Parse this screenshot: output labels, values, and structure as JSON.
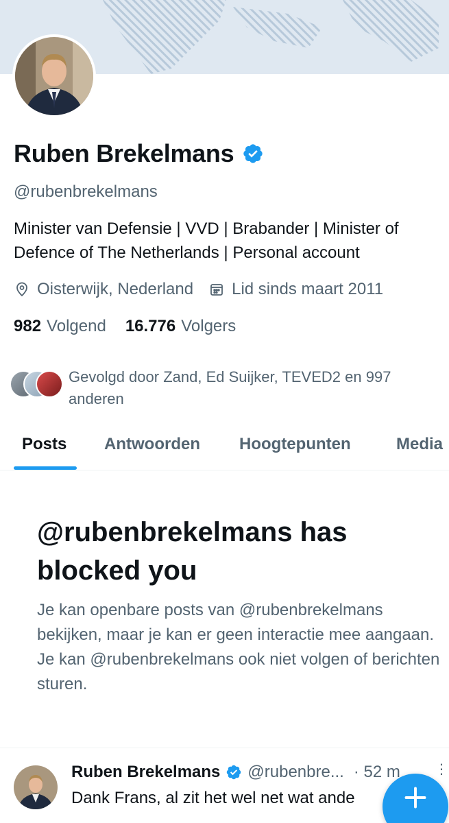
{
  "profile": {
    "name": "Ruben Brekelmans",
    "handle": "@rubenbrekelmans",
    "bio": "Minister van Defensie | VVD | Brabander |  Minister of\nDefence of The Netherlands | Personal account",
    "location": "Oisterwijk, Nederland",
    "joined": "Lid sinds maart 2011",
    "following_count": "982",
    "following_label": "Volgend",
    "followers_count": "16.776",
    "followers_label": "Volgers",
    "followed_by": "Gevolgd door Zand, Ed Suijker, TEVED2 en 997 anderen"
  },
  "tabs": [
    {
      "label": "Posts",
      "active": true
    },
    {
      "label": "Antwoorden",
      "active": false
    },
    {
      "label": "Hoogtepunten",
      "active": false
    },
    {
      "label": "Media",
      "active": false
    }
  ],
  "blocked": {
    "title": "@rubenbrekelmans has blocked you",
    "message": "Je kan openbare posts van @rubenbrekelmans bekijken, maar je kan er geen interactie mee aangaan. Je kan @rubenbrekelmans ook niet volgen of berichten sturen."
  },
  "post": {
    "author": "Ruben Brekelmans",
    "handle": "@rubenbre...",
    "time": "· 52 m",
    "text": "Dank Frans, al zit het wel net wat ande"
  },
  "icons": {
    "location": "location-pin-icon",
    "calendar": "calendar-icon",
    "verified": "verified-badge-icon",
    "compose": "plus-icon",
    "more": "more-vertical-icon"
  },
  "colors": {
    "accent": "#1d9bf0",
    "text": "#0f1419",
    "secondary": "#536471",
    "banner": "#dfe8f1"
  }
}
